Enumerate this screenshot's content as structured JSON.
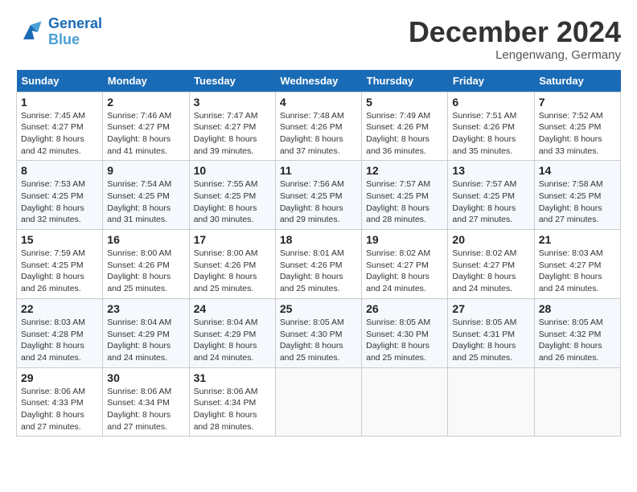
{
  "header": {
    "logo_line1": "General",
    "logo_line2": "Blue",
    "month_title": "December 2024",
    "location": "Lengenwang, Germany"
  },
  "weekdays": [
    "Sunday",
    "Monday",
    "Tuesday",
    "Wednesday",
    "Thursday",
    "Friday",
    "Saturday"
  ],
  "weeks": [
    [
      {
        "day": "1",
        "sunrise": "Sunrise: 7:45 AM",
        "sunset": "Sunset: 4:27 PM",
        "daylight": "Daylight: 8 hours and 42 minutes."
      },
      {
        "day": "2",
        "sunrise": "Sunrise: 7:46 AM",
        "sunset": "Sunset: 4:27 PM",
        "daylight": "Daylight: 8 hours and 41 minutes."
      },
      {
        "day": "3",
        "sunrise": "Sunrise: 7:47 AM",
        "sunset": "Sunset: 4:27 PM",
        "daylight": "Daylight: 8 hours and 39 minutes."
      },
      {
        "day": "4",
        "sunrise": "Sunrise: 7:48 AM",
        "sunset": "Sunset: 4:26 PM",
        "daylight": "Daylight: 8 hours and 37 minutes."
      },
      {
        "day": "5",
        "sunrise": "Sunrise: 7:49 AM",
        "sunset": "Sunset: 4:26 PM",
        "daylight": "Daylight: 8 hours and 36 minutes."
      },
      {
        "day": "6",
        "sunrise": "Sunrise: 7:51 AM",
        "sunset": "Sunset: 4:26 PM",
        "daylight": "Daylight: 8 hours and 35 minutes."
      },
      {
        "day": "7",
        "sunrise": "Sunrise: 7:52 AM",
        "sunset": "Sunset: 4:25 PM",
        "daylight": "Daylight: 8 hours and 33 minutes."
      }
    ],
    [
      {
        "day": "8",
        "sunrise": "Sunrise: 7:53 AM",
        "sunset": "Sunset: 4:25 PM",
        "daylight": "Daylight: 8 hours and 32 minutes."
      },
      {
        "day": "9",
        "sunrise": "Sunrise: 7:54 AM",
        "sunset": "Sunset: 4:25 PM",
        "daylight": "Daylight: 8 hours and 31 minutes."
      },
      {
        "day": "10",
        "sunrise": "Sunrise: 7:55 AM",
        "sunset": "Sunset: 4:25 PM",
        "daylight": "Daylight: 8 hours and 30 minutes."
      },
      {
        "day": "11",
        "sunrise": "Sunrise: 7:56 AM",
        "sunset": "Sunset: 4:25 PM",
        "daylight": "Daylight: 8 hours and 29 minutes."
      },
      {
        "day": "12",
        "sunrise": "Sunrise: 7:57 AM",
        "sunset": "Sunset: 4:25 PM",
        "daylight": "Daylight: 8 hours and 28 minutes."
      },
      {
        "day": "13",
        "sunrise": "Sunrise: 7:57 AM",
        "sunset": "Sunset: 4:25 PM",
        "daylight": "Daylight: 8 hours and 27 minutes."
      },
      {
        "day": "14",
        "sunrise": "Sunrise: 7:58 AM",
        "sunset": "Sunset: 4:25 PM",
        "daylight": "Daylight: 8 hours and 27 minutes."
      }
    ],
    [
      {
        "day": "15",
        "sunrise": "Sunrise: 7:59 AM",
        "sunset": "Sunset: 4:25 PM",
        "daylight": "Daylight: 8 hours and 26 minutes."
      },
      {
        "day": "16",
        "sunrise": "Sunrise: 8:00 AM",
        "sunset": "Sunset: 4:26 PM",
        "daylight": "Daylight: 8 hours and 25 minutes."
      },
      {
        "day": "17",
        "sunrise": "Sunrise: 8:00 AM",
        "sunset": "Sunset: 4:26 PM",
        "daylight": "Daylight: 8 hours and 25 minutes."
      },
      {
        "day": "18",
        "sunrise": "Sunrise: 8:01 AM",
        "sunset": "Sunset: 4:26 PM",
        "daylight": "Daylight: 8 hours and 25 minutes."
      },
      {
        "day": "19",
        "sunrise": "Sunrise: 8:02 AM",
        "sunset": "Sunset: 4:27 PM",
        "daylight": "Daylight: 8 hours and 24 minutes."
      },
      {
        "day": "20",
        "sunrise": "Sunrise: 8:02 AM",
        "sunset": "Sunset: 4:27 PM",
        "daylight": "Daylight: 8 hours and 24 minutes."
      },
      {
        "day": "21",
        "sunrise": "Sunrise: 8:03 AM",
        "sunset": "Sunset: 4:27 PM",
        "daylight": "Daylight: 8 hours and 24 minutes."
      }
    ],
    [
      {
        "day": "22",
        "sunrise": "Sunrise: 8:03 AM",
        "sunset": "Sunset: 4:28 PM",
        "daylight": "Daylight: 8 hours and 24 minutes."
      },
      {
        "day": "23",
        "sunrise": "Sunrise: 8:04 AM",
        "sunset": "Sunset: 4:29 PM",
        "daylight": "Daylight: 8 hours and 24 minutes."
      },
      {
        "day": "24",
        "sunrise": "Sunrise: 8:04 AM",
        "sunset": "Sunset: 4:29 PM",
        "daylight": "Daylight: 8 hours and 24 minutes."
      },
      {
        "day": "25",
        "sunrise": "Sunrise: 8:05 AM",
        "sunset": "Sunset: 4:30 PM",
        "daylight": "Daylight: 8 hours and 25 minutes."
      },
      {
        "day": "26",
        "sunrise": "Sunrise: 8:05 AM",
        "sunset": "Sunset: 4:30 PM",
        "daylight": "Daylight: 8 hours and 25 minutes."
      },
      {
        "day": "27",
        "sunrise": "Sunrise: 8:05 AM",
        "sunset": "Sunset: 4:31 PM",
        "daylight": "Daylight: 8 hours and 25 minutes."
      },
      {
        "day": "28",
        "sunrise": "Sunrise: 8:05 AM",
        "sunset": "Sunset: 4:32 PM",
        "daylight": "Daylight: 8 hours and 26 minutes."
      }
    ],
    [
      {
        "day": "29",
        "sunrise": "Sunrise: 8:06 AM",
        "sunset": "Sunset: 4:33 PM",
        "daylight": "Daylight: 8 hours and 27 minutes."
      },
      {
        "day": "30",
        "sunrise": "Sunrise: 8:06 AM",
        "sunset": "Sunset: 4:34 PM",
        "daylight": "Daylight: 8 hours and 27 minutes."
      },
      {
        "day": "31",
        "sunrise": "Sunrise: 8:06 AM",
        "sunset": "Sunset: 4:34 PM",
        "daylight": "Daylight: 8 hours and 28 minutes."
      },
      null,
      null,
      null,
      null
    ]
  ]
}
